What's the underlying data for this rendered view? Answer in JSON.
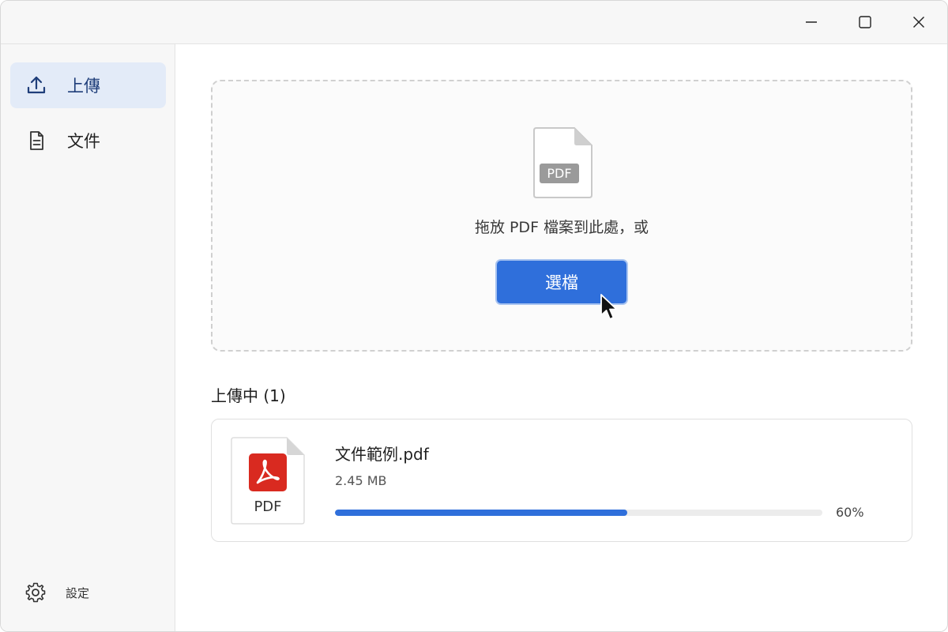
{
  "window": {
    "controls": [
      "minimize",
      "maximize",
      "close"
    ]
  },
  "sidebar": {
    "items": [
      {
        "label": "上傳",
        "icon": "upload-icon",
        "active": true
      },
      {
        "label": "文件",
        "icon": "document-icon",
        "active": false
      }
    ],
    "settings_label": "設定"
  },
  "dropzone": {
    "badge": "PDF",
    "prompt": "拖放 PDF 檔案到此處，或",
    "button_label": "選檔"
  },
  "uploads": {
    "title": "上傳中 (1)",
    "files": [
      {
        "name": "文件範例.pdf",
        "size": "2.45 MB",
        "progress": 0.6,
        "progress_label": "60%",
        "thumb_label": "PDF"
      }
    ]
  },
  "colors": {
    "accent": "#2f6fdb",
    "active_nav_bg": "#e3ebf8",
    "pdf_red": "#d92a20"
  }
}
